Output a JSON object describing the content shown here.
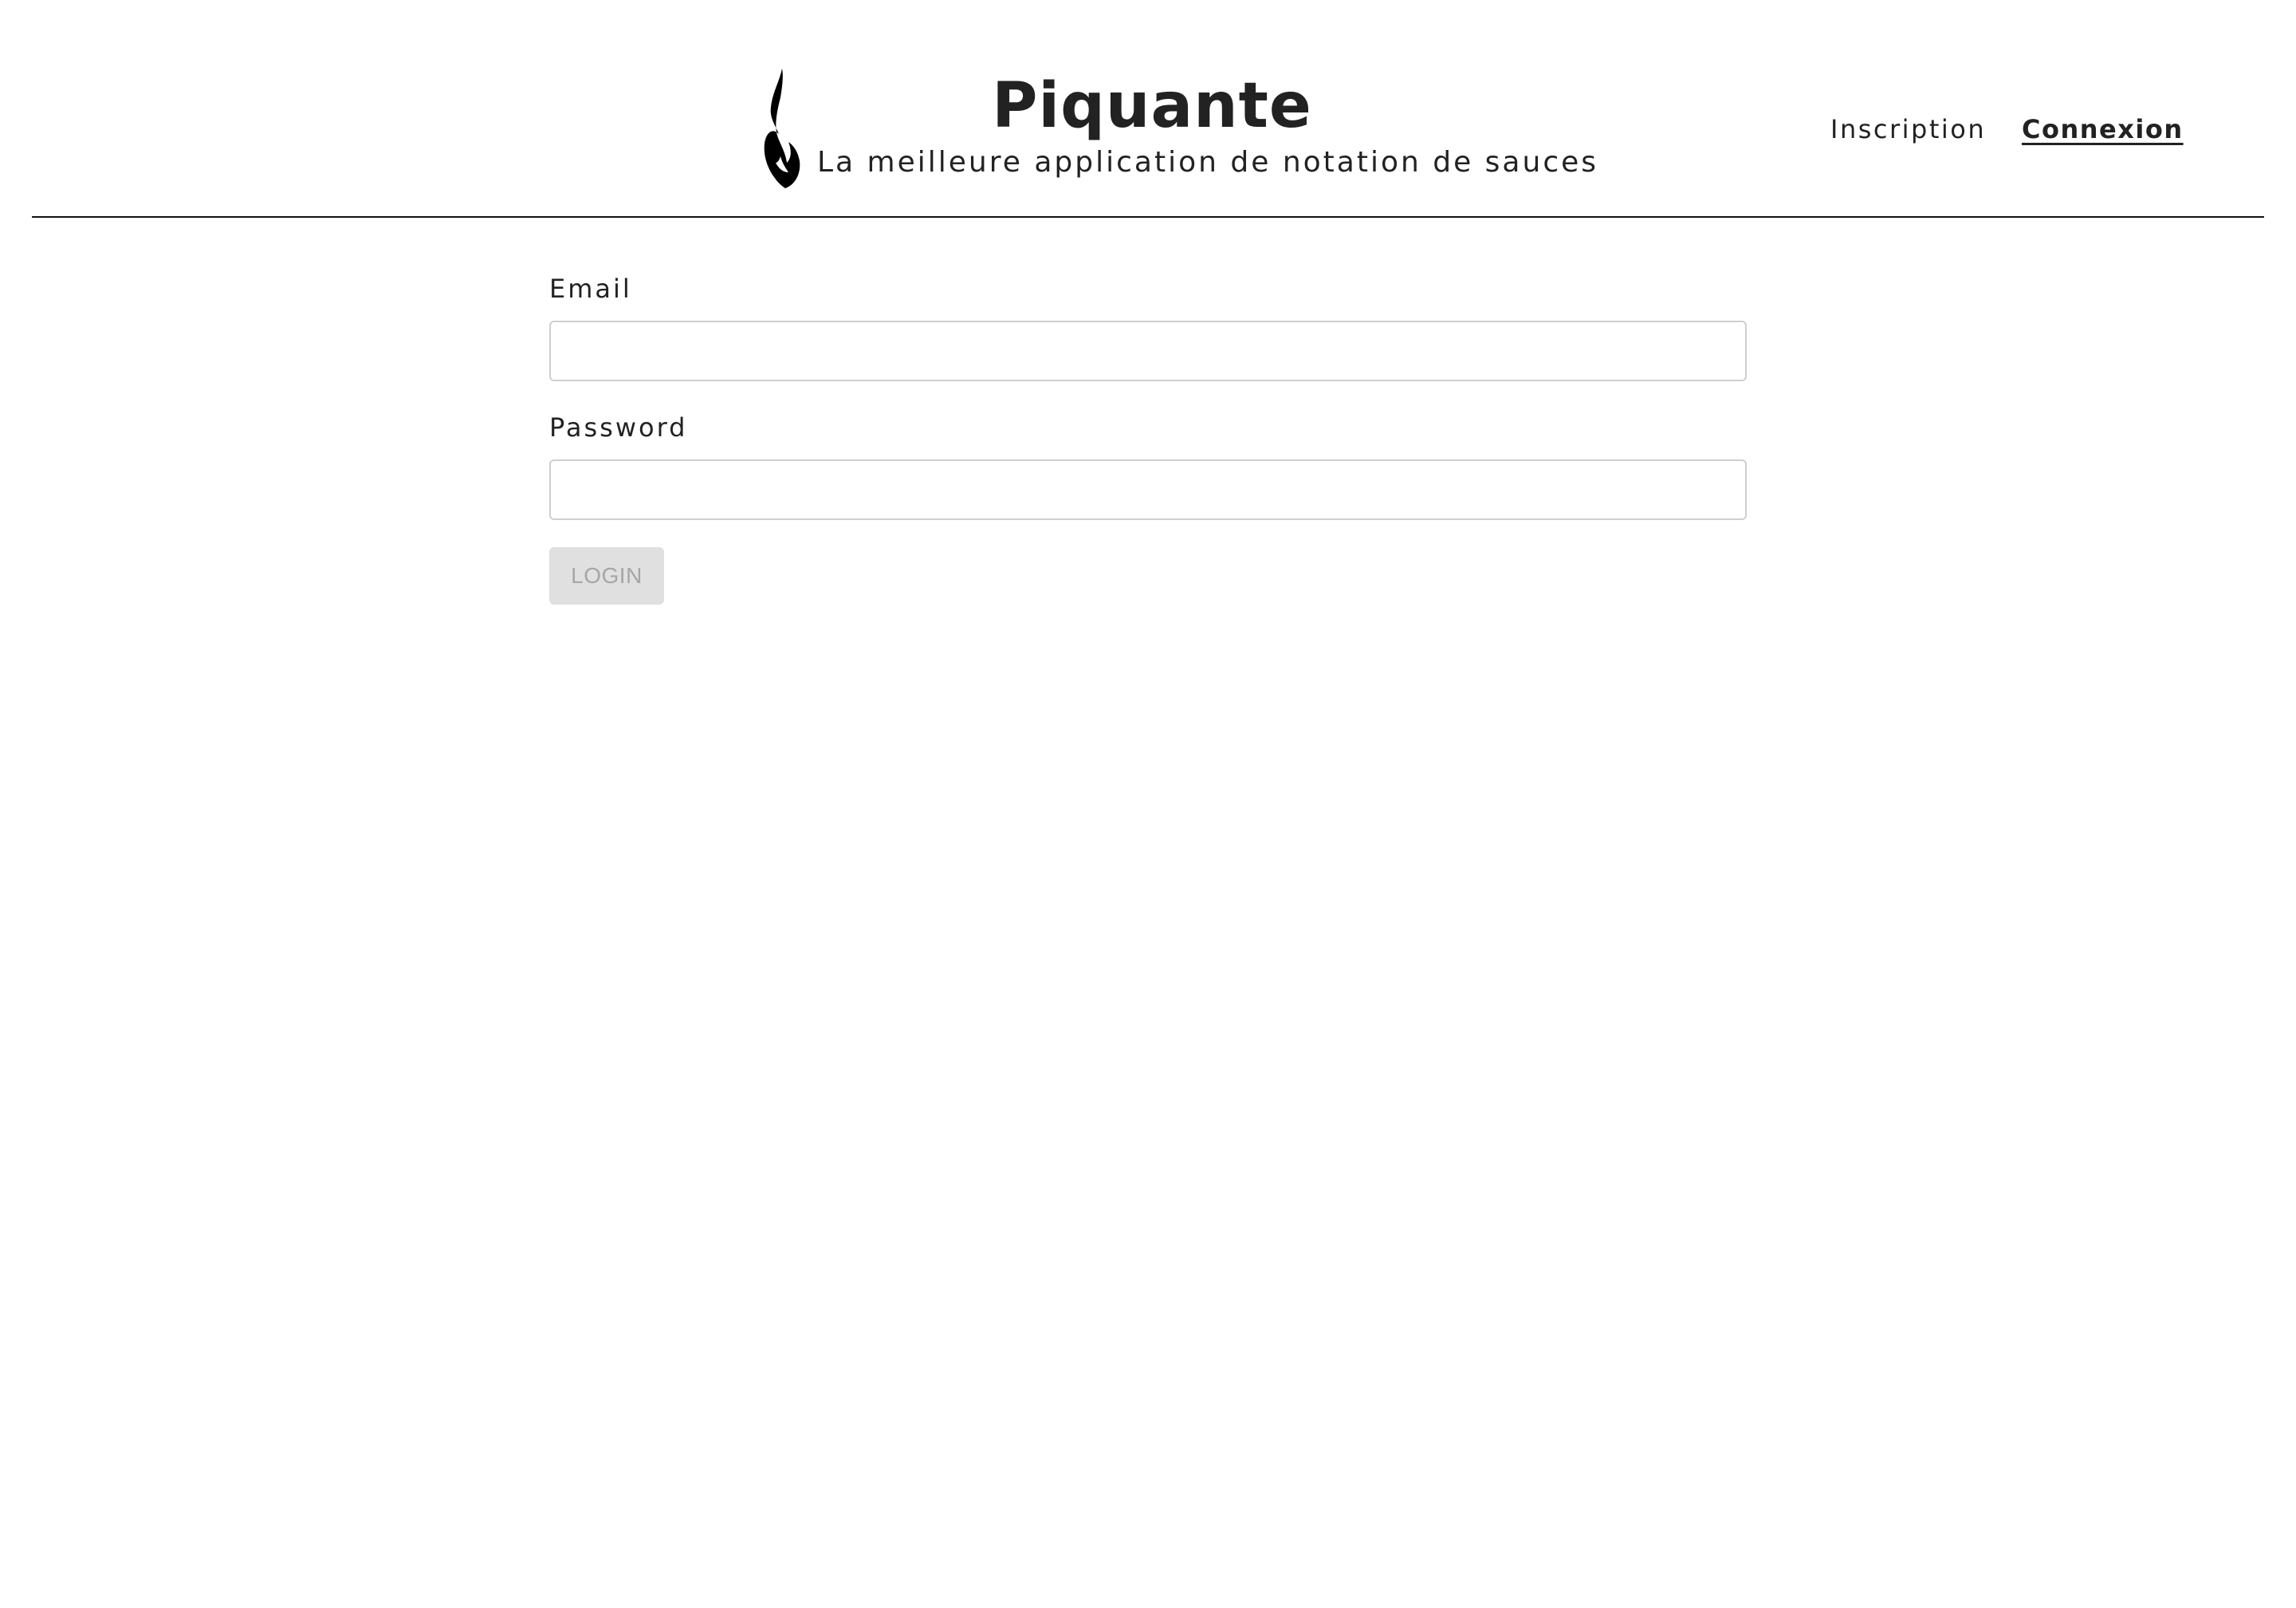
{
  "header": {
    "logo_icon": "flame-icon",
    "title": "Piquante",
    "tagline": "La meilleure application de notation de sauces",
    "nav": {
      "signup_label": "Inscription",
      "login_label": "Connexion",
      "active": "Connexion"
    }
  },
  "login_form": {
    "email_label": "Email",
    "email_value": "",
    "email_placeholder": "",
    "password_label": "Password",
    "password_value": "",
    "password_placeholder": "",
    "submit_label": "LOGIN",
    "submit_disabled": true
  },
  "colors": {
    "text": "#222222",
    "divider": "#111111",
    "input_border": "#cfcfcf",
    "button_bg_disabled": "#e0e0e0",
    "button_text_disabled": "#a6a6a6",
    "background": "#ffffff"
  }
}
